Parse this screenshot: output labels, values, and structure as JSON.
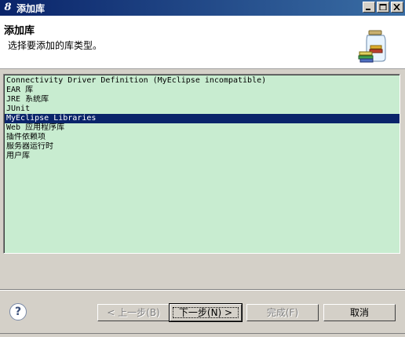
{
  "window": {
    "icon_glyph": "8",
    "title": "添加库"
  },
  "header": {
    "title": "添加库",
    "description": "选择要添加的库类型。",
    "icon": "library-jar-icon"
  },
  "library_types": [
    "Connectivity Driver Definition (MyEclipse incompatible)",
    "EAR 库",
    "JRE 系统库",
    "JUnit",
    "MyEclipse Libraries",
    "Web 应用程序库",
    "插件依赖项",
    "服务器运行时",
    "用户库"
  ],
  "selected_index": 4,
  "buttons": {
    "back": "< 上一步(B)",
    "next": "下一步(N) >",
    "finish": "完成(F)",
    "cancel": "取消"
  },
  "help_glyph": "?",
  "colors": {
    "list_background": "#c8ecd0",
    "selection": "#0a246a",
    "title_bar": "#0a246a"
  }
}
